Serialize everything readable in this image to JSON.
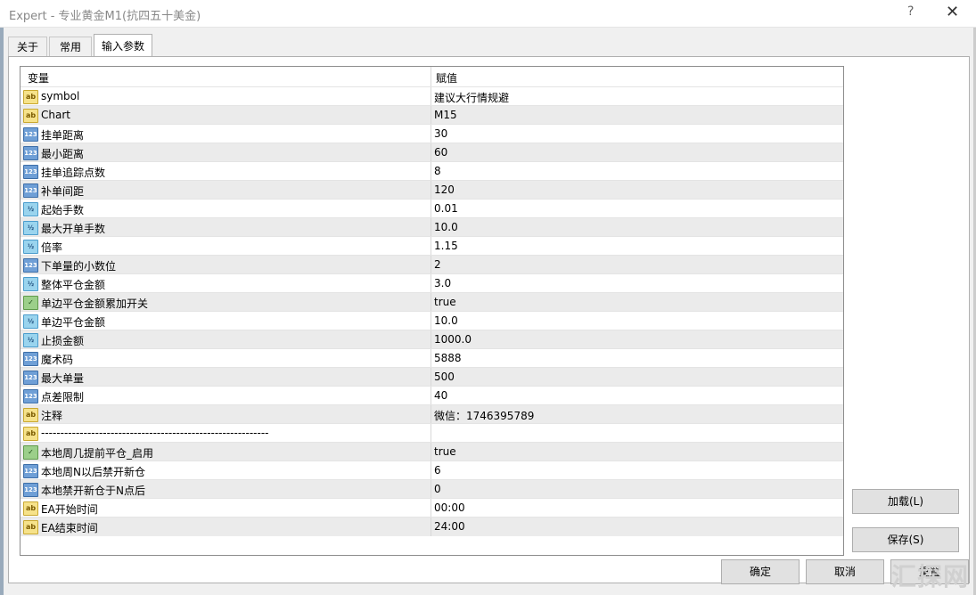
{
  "window": {
    "title": "Expert - 专业黄金M1(抗四五十美金)",
    "help": "?",
    "close": "✕"
  },
  "tabs": [
    {
      "label": "关于"
    },
    {
      "label": "常用"
    },
    {
      "label": "输入参数",
      "active": true
    }
  ],
  "grid": {
    "col_variable": "变量",
    "col_value": "赋值",
    "rows": [
      {
        "type": "ab",
        "name": "symbol",
        "value": "建议大行情规避"
      },
      {
        "type": "ab",
        "name": "Chart",
        "value": "M15"
      },
      {
        "type": "num",
        "name": "挂单距离",
        "value": "30"
      },
      {
        "type": "num",
        "name": "最小距离",
        "value": "60"
      },
      {
        "type": "num",
        "name": "挂单追踪点数",
        "value": "8"
      },
      {
        "type": "num",
        "name": "补单间距",
        "value": "120"
      },
      {
        "type": "dbl",
        "name": "起始手数",
        "value": "0.01"
      },
      {
        "type": "dbl",
        "name": "最大开单手数",
        "value": "10.0"
      },
      {
        "type": "dbl",
        "name": "倍率",
        "value": "1.15"
      },
      {
        "type": "num",
        "name": "下单量的小数位",
        "value": "2"
      },
      {
        "type": "dbl",
        "name": "整体平仓金额",
        "value": "3.0"
      },
      {
        "type": "bool",
        "name": "单边平仓金额累加开关",
        "value": "true"
      },
      {
        "type": "dbl",
        "name": "单边平仓金额",
        "value": "10.0"
      },
      {
        "type": "dbl",
        "name": "止损金额",
        "value": "1000.0"
      },
      {
        "type": "num",
        "name": "魔术码",
        "value": "5888"
      },
      {
        "type": "num",
        "name": "最大单量",
        "value": "500"
      },
      {
        "type": "num",
        "name": "点差限制",
        "value": "40"
      },
      {
        "type": "ab",
        "name": "注释",
        "value": "微信：1746395789"
      },
      {
        "type": "ab",
        "name": "-----------------------------------------------------------",
        "value": ""
      },
      {
        "type": "bool",
        "name": "本地周几提前平仓_启用",
        "value": "true"
      },
      {
        "type": "num",
        "name": "本地周N以后禁开新仓",
        "value": "6"
      },
      {
        "type": "num",
        "name": "本地禁开新仓于N点后",
        "value": "0"
      },
      {
        "type": "ab",
        "name": "EA开始时间",
        "value": "00:00"
      },
      {
        "type": "ab",
        "name": "EA结束时间",
        "value": "24:00"
      }
    ]
  },
  "icons": {
    "ab": "ab",
    "num": "123",
    "dbl": "½",
    "bool": "✓"
  },
  "buttons": {
    "load": "加载(L)",
    "save": "保存(S)",
    "ok": "确定",
    "cancel": "取消",
    "reset": "重置"
  },
  "watermark": "汇探网"
}
